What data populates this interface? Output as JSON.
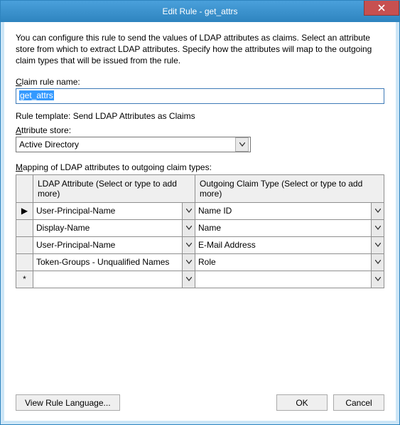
{
  "window": {
    "title": "Edit Rule - get_attrs"
  },
  "description": "You can configure this rule to send the values of LDAP attributes as claims. Select an attribute store from which to extract LDAP attributes. Specify how the attributes will map to the outgoing claim types that will be issued from the rule.",
  "labels": {
    "rule_name": "Claim rule name:",
    "rule_name_key": "C",
    "store": "Attribute store:",
    "store_key": "A",
    "mapping": "Mapping of LDAP attributes to outgoing claim types:",
    "mapping_key": "M"
  },
  "rule_name_value": "get_attrs",
  "template_line": "Rule template: Send LDAP Attributes as Claims",
  "store_value": "Active Directory",
  "grid": {
    "col_ldap": "LDAP Attribute (Select or type to add more)",
    "col_out": "Outgoing Claim Type (Select or type to add more)",
    "rows": [
      {
        "marker": "▶",
        "ldap": "User-Principal-Name",
        "out": "Name ID"
      },
      {
        "marker": "",
        "ldap": "Display-Name",
        "out": "Name"
      },
      {
        "marker": "",
        "ldap": "User-Principal-Name",
        "out": "E-Mail Address"
      },
      {
        "marker": "",
        "ldap": "Token-Groups - Unqualified Names",
        "out": "Role"
      },
      {
        "marker": "*",
        "ldap": "",
        "out": ""
      }
    ]
  },
  "buttons": {
    "view_lang": "View Rule Language...",
    "ok": "OK",
    "cancel": "Cancel"
  }
}
